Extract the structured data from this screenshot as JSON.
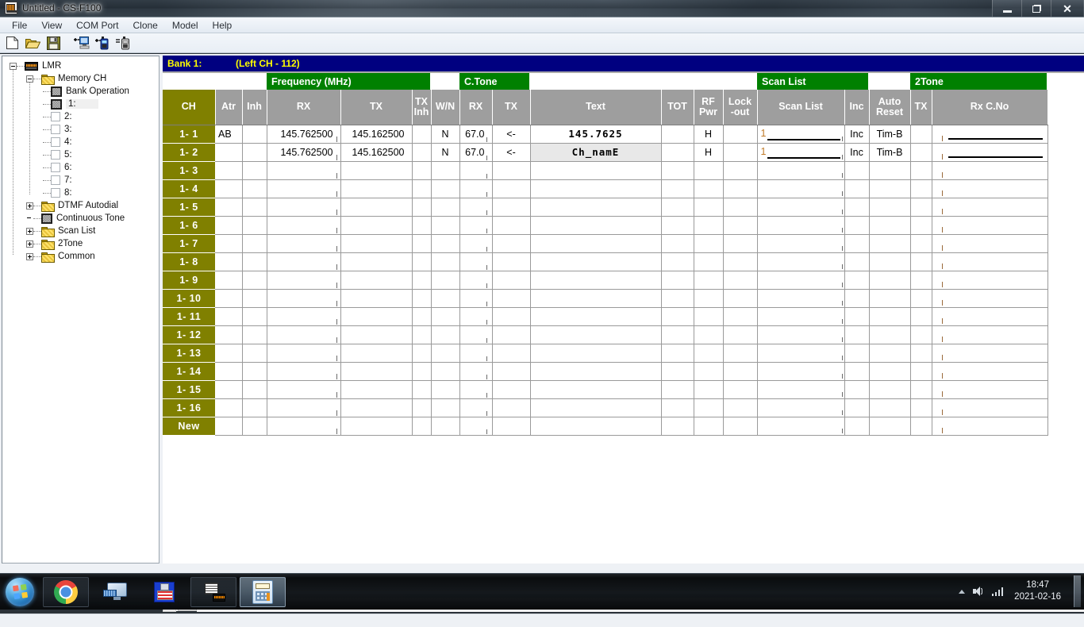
{
  "window": {
    "title": "Untitled - CS-F100",
    "app_icon": "radio-programmer-icon",
    "minimize": "–",
    "maximize": "❐",
    "close": "✕"
  },
  "menu": {
    "items": [
      "File",
      "View",
      "COM Port",
      "Clone",
      "Model",
      "Help"
    ]
  },
  "toolbar": {
    "buttons": [
      {
        "name": "new-file-button",
        "icon": "new-document-icon"
      },
      {
        "name": "open-file-button",
        "icon": "open-folder-icon"
      },
      {
        "name": "save-file-button",
        "icon": "floppy-save-icon"
      },
      {
        "name": "clone-read-button",
        "icon": "radio-to-pc-icon"
      },
      {
        "name": "clone-write-button",
        "icon": "pc-to-radio-icon"
      },
      {
        "name": "clone-compare-button",
        "icon": "compare-radio-icon"
      }
    ]
  },
  "tree": {
    "root": {
      "label": "LMR",
      "icon": "radio-icon",
      "expanded": true
    },
    "memory_ch": {
      "label": "Memory CH",
      "icon": "folder-icon",
      "expanded": true
    },
    "children": [
      {
        "label": "Bank Operation",
        "icon": "page-icon",
        "selected": false
      },
      {
        "label": "1:",
        "icon": "page-icon",
        "selected": true
      },
      {
        "label": "2:",
        "icon": "empty-page-icon",
        "selected": false
      },
      {
        "label": "3:",
        "icon": "empty-page-icon",
        "selected": false
      },
      {
        "label": "4:",
        "icon": "empty-page-icon",
        "selected": false
      },
      {
        "label": "5:",
        "icon": "empty-page-icon",
        "selected": false
      },
      {
        "label": "6:",
        "icon": "empty-page-icon",
        "selected": false
      },
      {
        "label": "7:",
        "icon": "empty-page-icon",
        "selected": false
      },
      {
        "label": "8:",
        "icon": "empty-page-icon",
        "selected": false
      }
    ],
    "siblings": [
      {
        "label": "DTMF Autodial",
        "icon": "folder-icon",
        "expander": "plus"
      },
      {
        "label": "Continuous Tone",
        "icon": "page-icon",
        "expander": "none"
      },
      {
        "label": "Scan List",
        "icon": "folder-icon",
        "expander": "plus"
      },
      {
        "label": "2Tone",
        "icon": "folder-icon",
        "expander": "plus"
      },
      {
        "label": "Common",
        "icon": "folder-icon",
        "expander": "plus"
      }
    ]
  },
  "grid": {
    "bank_title": "Bank 1:",
    "bank_subtitle": "(Left CH - 112)",
    "group_headers": {
      "frequency": "Frequency (MHz)",
      "ctone": "C.Tone",
      "scanlist": "Scan List",
      "twotone": "2Tone"
    },
    "columns": [
      "CH",
      "Atr",
      "Inh",
      "RX",
      "TX",
      "TX\nInh",
      "W/N",
      "RX",
      "TX",
      "Text",
      "TOT",
      "RF\nPwr",
      "Lock\n-out",
      "Scan List",
      "Inc",
      "Auto\nReset",
      "TX",
      "Rx C.No"
    ],
    "columns_flat": {
      "ch": "CH",
      "atr": "Atr",
      "inh": "Inh",
      "rx_freq": "RX",
      "tx_freq": "TX",
      "tx_inh_l1": "TX",
      "tx_inh_l2": "Inh",
      "wn": "W/N",
      "ctone_rx": "RX",
      "ctone_tx": "TX",
      "text": "Text",
      "tot": "TOT",
      "rfpwr_l1": "RF",
      "rfpwr_l2": "Pwr",
      "lockout_l1": "Lock",
      "lockout_l2": "-out",
      "scanlist": "Scan List",
      "inc": "Inc",
      "autoreset_l1": "Auto",
      "autoreset_l2": "Reset",
      "twotone_tx": "TX",
      "rx_cno": "Rx C.No"
    },
    "rows": [
      {
        "ch": "1- 1",
        "atr": "AB",
        "inh": "",
        "rx": "145.762500",
        "tx": "145.162500",
        "tx_inh": "",
        "wn": "N",
        "ctone_rx": "67.0",
        "ctone_tx": "<-",
        "text": "145.7625",
        "text_selected": false,
        "tot": "",
        "rf_pwr": "H",
        "lockout": "",
        "scan_list": "1",
        "inc": "Inc",
        "auto_reset": "Tim-B",
        "tt_tx": "",
        "rx_cno": ""
      },
      {
        "ch": "1- 2",
        "atr": "",
        "inh": "",
        "rx": "145.762500",
        "tx": "145.162500",
        "tx_inh": "",
        "wn": "N",
        "ctone_rx": "67.0",
        "ctone_tx": "<-",
        "text": "Ch_namE",
        "text_selected": true,
        "tot": "",
        "rf_pwr": "H",
        "lockout": "",
        "scan_list": "1",
        "inc": "Inc",
        "auto_reset": "Tim-B",
        "tt_tx": "",
        "rx_cno": ""
      },
      {
        "ch": "1- 3",
        "empty": true
      },
      {
        "ch": "1- 4",
        "empty": true
      },
      {
        "ch": "1- 5",
        "empty": true
      },
      {
        "ch": "1- 6",
        "empty": true
      },
      {
        "ch": "1- 7",
        "empty": true
      },
      {
        "ch": "1- 8",
        "empty": true
      },
      {
        "ch": "1- 9",
        "empty": true
      },
      {
        "ch": "1- 10",
        "empty": true
      },
      {
        "ch": "1- 11",
        "empty": true
      },
      {
        "ch": "1- 12",
        "empty": true
      },
      {
        "ch": "1- 13",
        "empty": true
      },
      {
        "ch": "1- 14",
        "empty": true
      },
      {
        "ch": "1- 15",
        "empty": true
      },
      {
        "ch": "1- 16",
        "empty": true
      },
      {
        "ch": "New",
        "empty": true,
        "is_new": true
      }
    ]
  },
  "colors": {
    "bank_bar_bg": "#000080",
    "bank_bar_text": "#ffff00",
    "group_header_green": "#008000",
    "column_header_gray": "#9e9e9e",
    "ch_column_olive": "#808000",
    "scanlist_number": "#c07a28"
  },
  "scrollbar": {
    "left_arrow": "◀"
  },
  "taskbar": {
    "start": "start-orb-icon",
    "items": [
      {
        "name": "taskbar-chrome",
        "icon": "chrome-icon"
      },
      {
        "name": "taskbar-remote-desktop",
        "icon": "monitor-keyboard-icon"
      },
      {
        "name": "taskbar-flag-floppy",
        "icon": "floppy-disk-icon"
      },
      {
        "name": "taskbar-radio-programmer",
        "icon": "radio-programmer-icon"
      },
      {
        "name": "taskbar-calculator",
        "icon": "calculator-icon"
      }
    ],
    "tray": {
      "show_hidden": "show-hidden-icons-chevron",
      "volume": "speaker-icon",
      "network": "signal-bars-icon",
      "time": "18:47",
      "date": "2021-02-16"
    }
  }
}
